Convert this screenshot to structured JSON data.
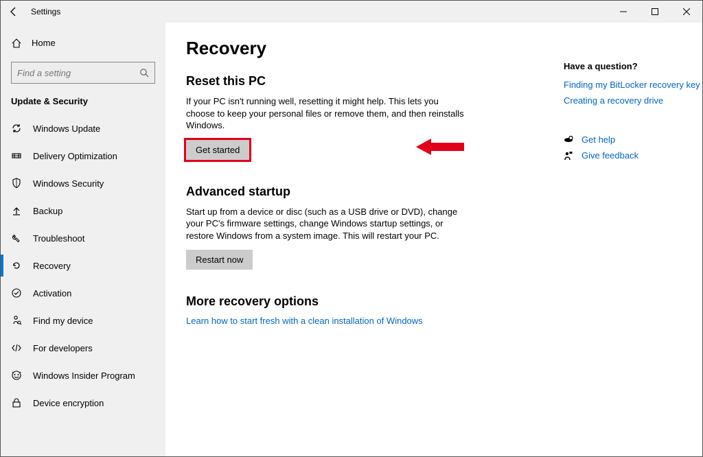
{
  "window": {
    "title": "Settings"
  },
  "sidebar": {
    "home_label": "Home",
    "search_placeholder": "Find a setting",
    "section_label": "Update & Security",
    "items": [
      {
        "label": "Windows Update",
        "icon": "sync"
      },
      {
        "label": "Delivery Optimization",
        "icon": "delivery"
      },
      {
        "label": "Windows Security",
        "icon": "shield"
      },
      {
        "label": "Backup",
        "icon": "backup"
      },
      {
        "label": "Troubleshoot",
        "icon": "troubleshoot"
      },
      {
        "label": "Recovery",
        "icon": "recovery",
        "active": true
      },
      {
        "label": "Activation",
        "icon": "activation"
      },
      {
        "label": "Find my device",
        "icon": "findmydevice"
      },
      {
        "label": "For developers",
        "icon": "developers"
      },
      {
        "label": "Windows Insider Program",
        "icon": "insider"
      },
      {
        "label": "Device encryption",
        "icon": "encryption"
      }
    ]
  },
  "page": {
    "title": "Recovery",
    "reset": {
      "heading": "Reset this PC",
      "body": "If your PC isn't running well, resetting it might help. This lets you choose to keep your personal files or remove them, and then reinstalls Windows.",
      "button": "Get started"
    },
    "advanced": {
      "heading": "Advanced startup",
      "body": "Start up from a device or disc (such as a USB drive or DVD), change your PC's firmware settings, change Windows startup settings, or restore Windows from a system image. This will restart your PC.",
      "button": "Restart now"
    },
    "more": {
      "heading": "More recovery options",
      "link": "Learn how to start fresh with a clean installation of Windows"
    }
  },
  "help": {
    "heading": "Have a question?",
    "links": [
      "Finding my BitLocker recovery key",
      "Creating a recovery drive"
    ],
    "get_help": "Get help",
    "feedback": "Give feedback"
  }
}
